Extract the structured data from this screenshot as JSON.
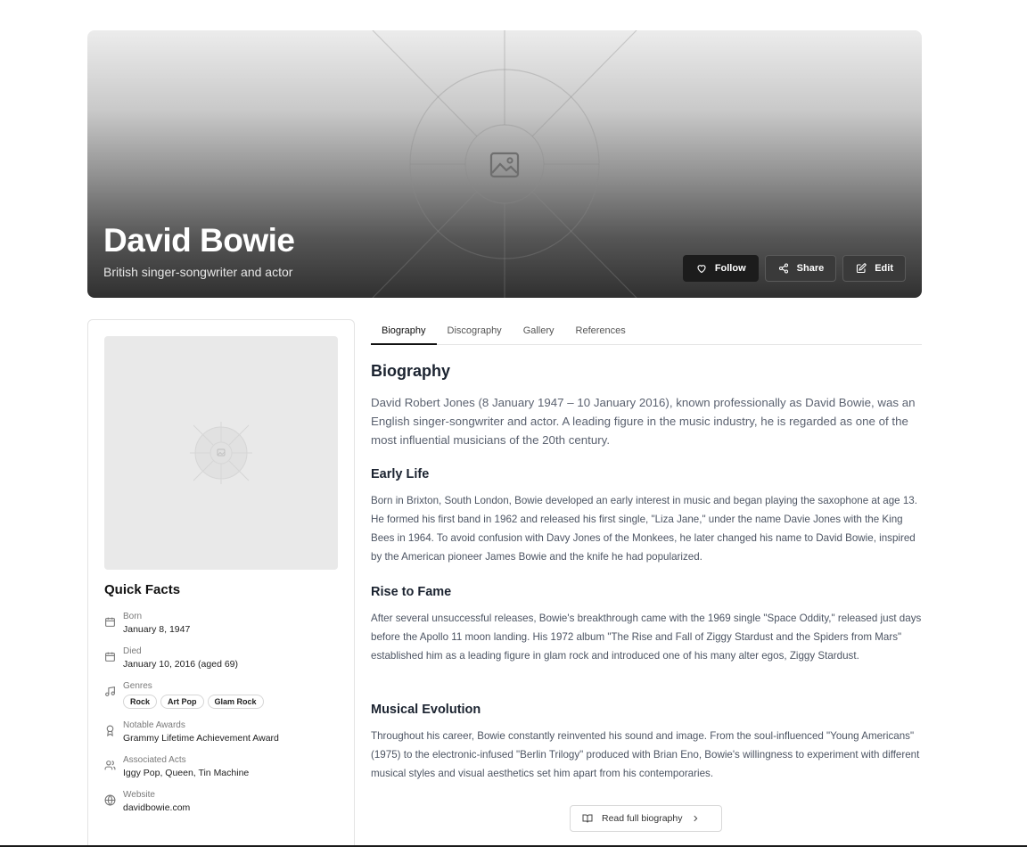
{
  "hero": {
    "title": "David Bowie",
    "subtitle": "British singer-songwriter and actor",
    "actions": {
      "follow": "Follow",
      "share": "Share",
      "edit": "Edit"
    }
  },
  "sidebar": {
    "quick_facts_title": "Quick Facts",
    "facts": [
      {
        "label": "Born",
        "value": "January 8, 1947",
        "icon": "calendar-icon"
      },
      {
        "label": "Died",
        "value": "January 10, 2016 (aged 69)",
        "icon": "calendar-icon"
      },
      {
        "label": "Genres",
        "tags": [
          "Rock",
          "Art Pop",
          "Glam Rock"
        ],
        "icon": "music-note-icon"
      },
      {
        "label": "Notable Awards",
        "value": "Grammy Lifetime Achievement Award",
        "icon": "award-icon"
      },
      {
        "label": "Associated Acts",
        "value": "Iggy Pop, Queen, Tin Machine",
        "icon": "users-icon"
      },
      {
        "label": "Website",
        "value": "davidbowie.com",
        "icon": "globe-icon"
      }
    ]
  },
  "tabs": [
    "Biography",
    "Discography",
    "Gallery",
    "References"
  ],
  "biography": {
    "heading": "Biography",
    "lead": "David Robert Jones (8 January 1947 – 10 January 2016), known professionally as David Bowie, was an English singer-songwriter and actor. A leading figure in the music industry, he is regarded as one of the most influential musicians of the 20th century.",
    "sections": [
      {
        "title": "Early Life",
        "text": "Born in Brixton, South London, Bowie developed an early interest in music and began playing the saxophone at age 13. He formed his first band in 1962 and released his first single, \"Liza Jane,\" under the name Davie Jones with the King Bees in 1964. To avoid confusion with Davy Jones of the Monkees, he later changed his name to David Bowie, inspired by the American pioneer James Bowie and the knife he had popularized."
      },
      {
        "title": "Rise to Fame",
        "text": "After several unsuccessful releases, Bowie's breakthrough came with the 1969 single \"Space Oddity,\" released just days before the Apollo 11 moon landing. His 1972 album \"The Rise and Fall of Ziggy Stardust and the Spiders from Mars\" established him as a leading figure in glam rock and introduced one of his many alter egos, Ziggy Stardust."
      },
      {
        "title": "Musical Evolution",
        "text": "Throughout his career, Bowie constantly reinvented his sound and image. From the soul-influenced \"Young Americans\" (1975) to the electronic-infused \"Berlin Trilogy\" produced with Brian Eno, Bowie's willingness to experiment with different musical styles and visual aesthetics set him apart from his contemporaries."
      }
    ],
    "read_more": "Read full biography"
  }
}
